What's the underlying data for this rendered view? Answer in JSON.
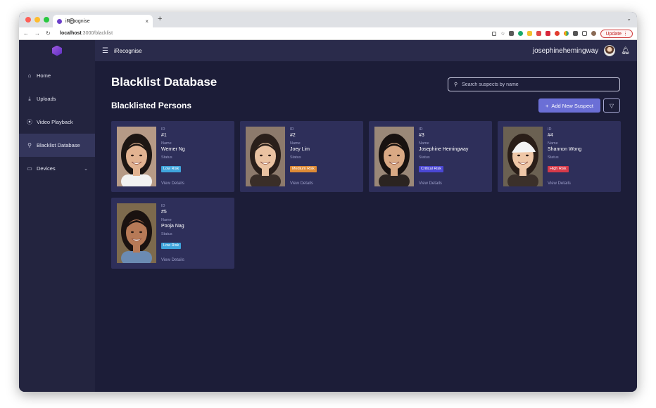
{
  "browser": {
    "tab_title": "iRecognise",
    "tab_close": "×",
    "new_tab": "+",
    "url_host": "localhost",
    "url_path": ":3000/blacklist",
    "update_label": "Update",
    "traffic_colors": [
      "#fe5f57",
      "#febc2e",
      "#28c840"
    ]
  },
  "sidebar": {
    "items": [
      {
        "icon": "home-icon",
        "glyph": "⌂",
        "label": "Home",
        "active": false
      },
      {
        "icon": "upload-icon",
        "glyph": "⤓",
        "label": "Uploads",
        "active": false
      },
      {
        "icon": "play-icon",
        "glyph": "⦿",
        "label": "Video Playback",
        "active": false
      },
      {
        "icon": "person-icon",
        "glyph": "⚲",
        "label": "Blacklist Database",
        "active": true
      },
      {
        "icon": "device-icon",
        "glyph": "▭",
        "label": "Devices",
        "active": false,
        "expandable": true
      }
    ]
  },
  "topbar": {
    "brand": "iRecognise",
    "username": "josephinehemingway"
  },
  "page": {
    "title": "Blacklist Database",
    "section_title": "Blacklisted Persons",
    "search_placeholder": "Search suspects by name",
    "add_button": "Add New Suspect"
  },
  "labels": {
    "id": "ID",
    "name": "Name",
    "status": "Status",
    "view_details": "View Details"
  },
  "suspects": [
    {
      "id": "#1",
      "name": "Werner Ng",
      "status": "Low Risk",
      "status_color": "#3fa4dc"
    },
    {
      "id": "#2",
      "name": "Joey Lim",
      "status": "Medium Risk",
      "status_color": "#dd8a36"
    },
    {
      "id": "#3",
      "name": "Josephine Hemingway",
      "status": "Critical Risk",
      "status_color": "#4a47d4"
    },
    {
      "id": "#4",
      "name": "Shannon Wong",
      "status": "High Risk",
      "status_color": "#d63a4a"
    },
    {
      "id": "#5",
      "name": "Pooja Nag",
      "status": "Low Risk",
      "status_color": "#3fa4dc"
    }
  ]
}
